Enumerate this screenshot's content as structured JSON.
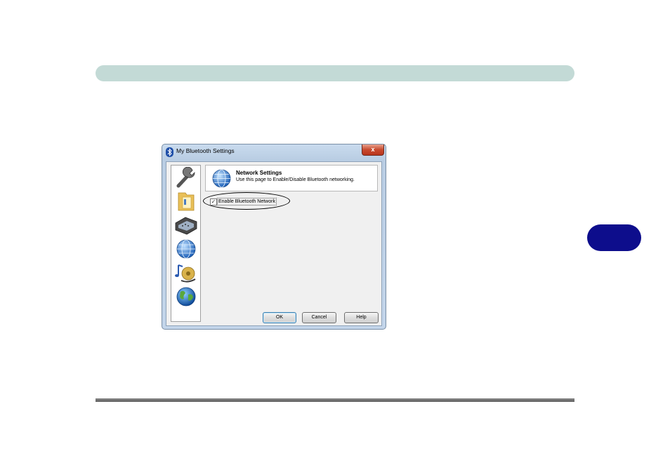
{
  "dialog": {
    "title": "My Bluetooth Settings",
    "close_label": "x"
  },
  "nav": {
    "items": [
      {
        "icon": "wrench-icon"
      },
      {
        "icon": "folder-icon"
      },
      {
        "icon": "serial-port-icon"
      },
      {
        "icon": "network-globe-icon"
      },
      {
        "icon": "music-headset-icon"
      },
      {
        "icon": "earth-globe-icon"
      }
    ]
  },
  "header": {
    "title": "Network Settings",
    "subtitle": "Use this page to Enable/Disable Bluetooth networking."
  },
  "option": {
    "label": "Enable Bluetooth Network",
    "checked": true,
    "check_glyph": "✓"
  },
  "buttons": {
    "ok": "OK",
    "cancel": "Cancel",
    "help": "Help"
  },
  "colors": {
    "header_bar": "#c3dad6",
    "side_tab": "#0d0d8c",
    "close_button": "#c84a2e"
  }
}
